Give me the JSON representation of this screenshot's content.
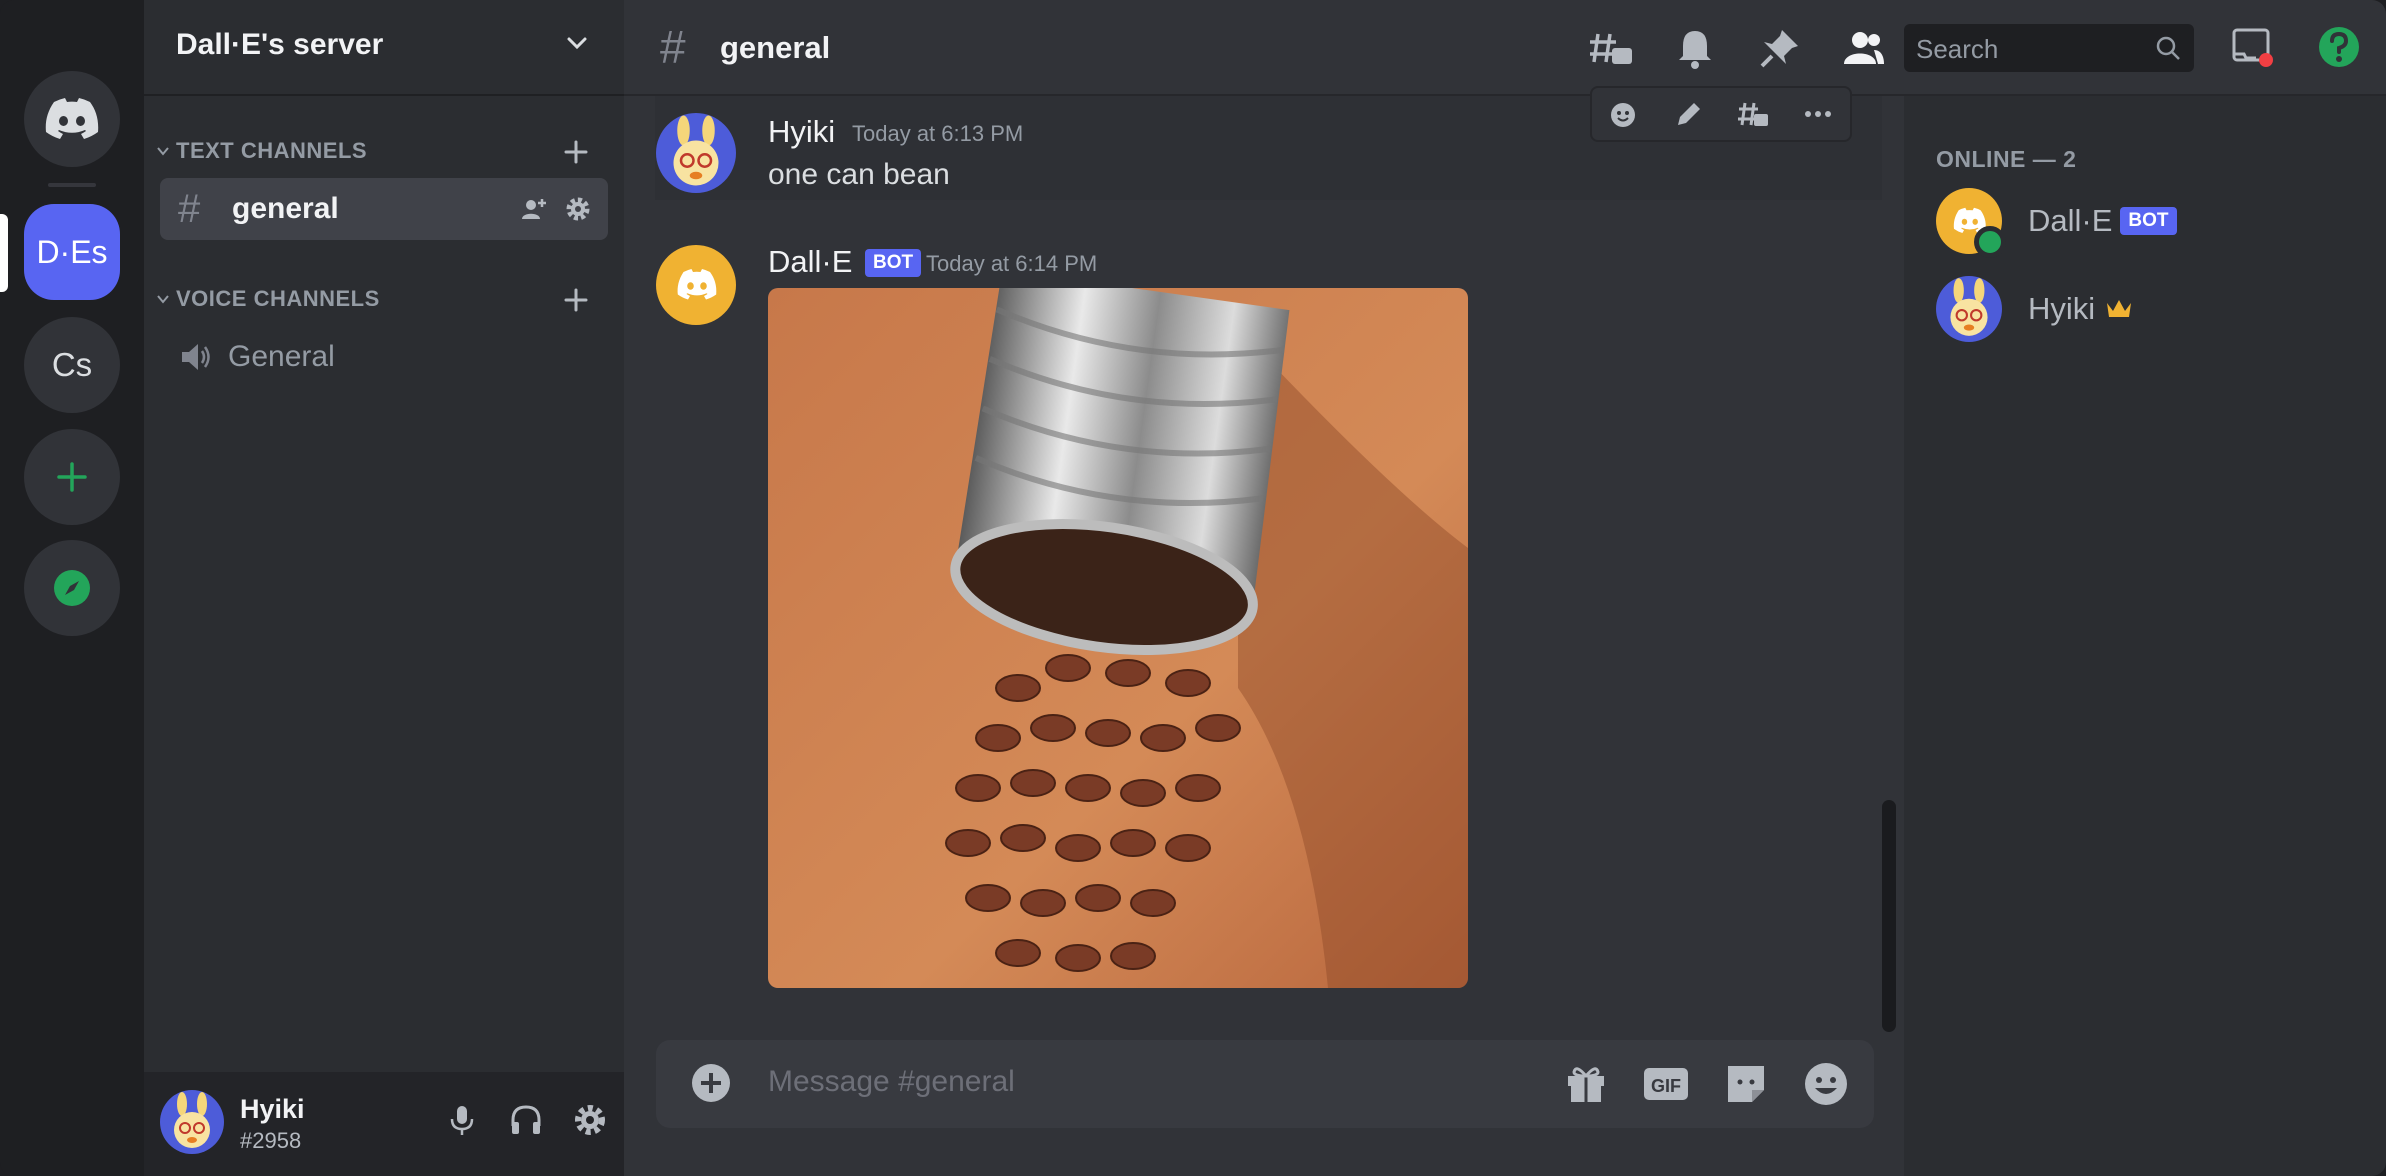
{
  "server": {
    "name": "Dall·E's server"
  },
  "rail": {
    "servers": [
      {
        "label": "D·Es",
        "active": true
      },
      {
        "label": "Cs",
        "active": false
      }
    ]
  },
  "sidebar": {
    "categories": [
      {
        "label": "TEXT CHANNELS"
      },
      {
        "label": "VOICE CHANNELS"
      }
    ],
    "text_channels": [
      {
        "name": "general",
        "active": true
      }
    ],
    "voice_channels": [
      {
        "name": "General"
      }
    ]
  },
  "user": {
    "name": "Hyiki",
    "tag": "#2958"
  },
  "channel": {
    "title": "general"
  },
  "search": {
    "placeholder": "Search"
  },
  "messages": [
    {
      "author": "Hyiki",
      "timestamp": "Today at 6:13 PM",
      "text": "one can bean"
    },
    {
      "author": "Dall·E",
      "badge": "BOT",
      "timestamp": "Today at 6:14 PM",
      "attachment": "image of kidney beans spilling from a tin can"
    }
  ],
  "composer": {
    "placeholder": "Message #general",
    "gif_label": "GIF"
  },
  "members": {
    "header": "ONLINE — 2",
    "list": [
      {
        "name": "Dall·E",
        "badge": "BOT",
        "status": "online"
      },
      {
        "name": "Hyiki",
        "crown": true
      }
    ]
  },
  "colors": {
    "accent": "#5865f2",
    "online": "#23a55a",
    "background": "#313338",
    "sidebar": "#2b2d31",
    "rail": "#1e1f22"
  }
}
